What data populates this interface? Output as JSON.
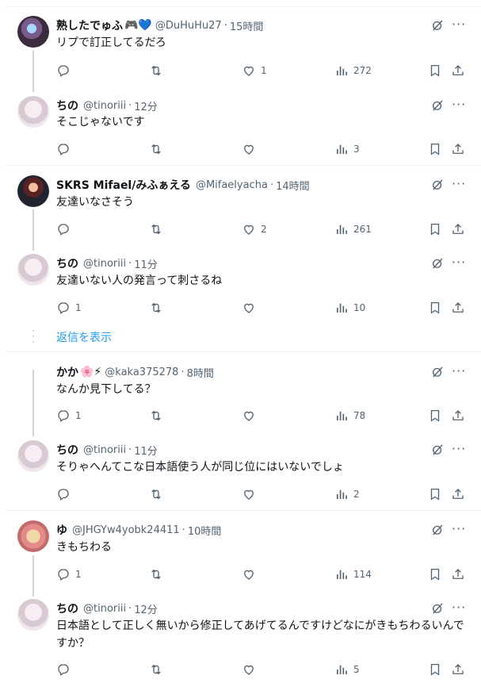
{
  "show_replies_label": "返信を表示",
  "tweets": [
    {
      "name": "熟したでゅふ",
      "emoji": "🎮💙",
      "handle": "@DuHuHu27",
      "sep": "·",
      "time": "15時間",
      "text": "リプで訂正してるだろ",
      "replies": "",
      "likes": "1",
      "views": "272",
      "avatar": "av-juku"
    },
    {
      "name": "ちの",
      "emoji": "",
      "handle": "@tinoriii",
      "sep": "·",
      "time": "12分",
      "text": "そこじゃないです",
      "replies": "",
      "likes": "",
      "views": "3",
      "avatar": "av-chino"
    },
    {
      "name": "SKRS Mifael/みふぁえる",
      "emoji": "",
      "handle": "@Mifaelyacha",
      "sep": "·",
      "time": "14時間",
      "text": "友達いなさそう",
      "replies": "",
      "likes": "2",
      "views": "261",
      "avatar": "av-skrs"
    },
    {
      "name": "ちの",
      "emoji": "",
      "handle": "@tinoriii",
      "sep": "·",
      "time": "11分",
      "text": "友達いない人の発言って刺さるね",
      "replies": "1",
      "likes": "",
      "views": "10",
      "avatar": "av-chino"
    },
    {
      "name": "かか",
      "emoji": "🌸⚡",
      "handle": "@kaka375278",
      "sep": "·",
      "time": "8時間",
      "text": "なんか見下してる？",
      "replies": "1",
      "likes": "",
      "views": "78",
      "avatar": ""
    },
    {
      "name": "ちの",
      "emoji": "",
      "handle": "@tinoriii",
      "sep": "·",
      "time": "11分",
      "text": "そりゃへんてこな日本語使う人が同じ位にはいないでしょ",
      "replies": "",
      "likes": "",
      "views": "2",
      "avatar": "av-chino"
    },
    {
      "name": "ゆ",
      "emoji": "",
      "handle": "@JHGYw4yobk24411",
      "sep": "·",
      "time": "10時間",
      "text": "きもちわる",
      "replies": "1",
      "likes": "",
      "views": "114",
      "avatar": "av-yu"
    },
    {
      "name": "ちの",
      "emoji": "",
      "handle": "@tinoriii",
      "sep": "·",
      "time": "12分",
      "text": "日本語として正しく無いから修正してあげてるんですけどなにがきもちわるいんですか？",
      "replies": "",
      "likes": "",
      "views": "5",
      "avatar": "av-chino"
    }
  ]
}
